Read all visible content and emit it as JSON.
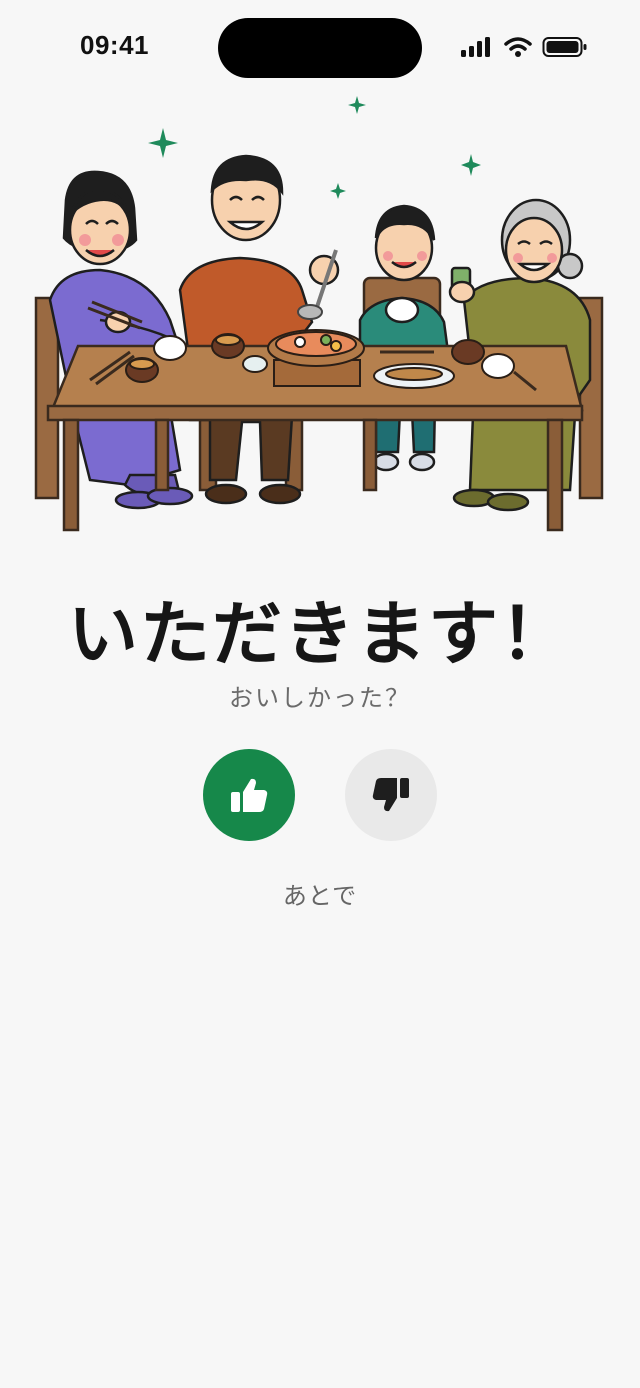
{
  "status_bar": {
    "time": "09:41",
    "icons": [
      "cellular-signal-icon",
      "wifi-icon",
      "battery-icon"
    ]
  },
  "illustration": {
    "subject": "family-dinner-illustration"
  },
  "main": {
    "headline": "いただきます！",
    "question": "おいしかった？",
    "like_icon": "thumbs-up-icon",
    "dislike_icon": "thumbs-down-icon",
    "later_label": "あとで"
  },
  "colors": {
    "background": "#f7f7f7",
    "accent_green": "#16884a",
    "neutral_button": "#e9e9e9",
    "text_primary": "#161616",
    "text_secondary": "#6b6b6b"
  }
}
